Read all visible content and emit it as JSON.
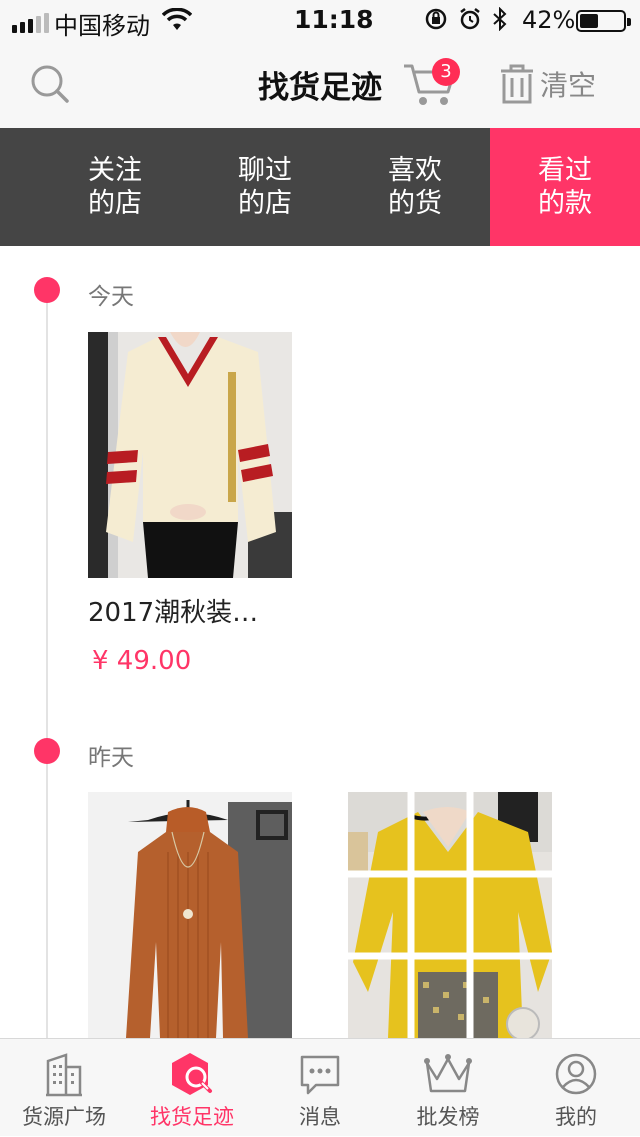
{
  "status_bar": {
    "carrier": "中国移动",
    "time": "11:18",
    "battery_percent": "42%",
    "battery_level": 0.42
  },
  "header": {
    "title": "找货足迹",
    "cart_count": "3",
    "clear_label": "清空",
    "icons": [
      "search-icon",
      "cart-icon",
      "trash-icon"
    ]
  },
  "tabs": [
    {
      "line1": "关注",
      "line2": "的店",
      "active": false
    },
    {
      "line1": "聊过",
      "line2": "的店",
      "active": false
    },
    {
      "line1": "喜欢",
      "line2": "的货",
      "active": false
    },
    {
      "line1": "看过",
      "line2": "的款",
      "active": true
    }
  ],
  "timeline": [
    {
      "date": "今天",
      "products": [
        {
          "name": "2017潮秋装…",
          "price": "¥ 49.00",
          "image": "cream-v-neck-sweater-with-red-stripes"
        }
      ]
    },
    {
      "date": "昨天",
      "products": [
        {
          "image": "rust-ribbed-turtleneck-sweater"
        },
        {
          "image": "yellow-v-neck-sweater-collage"
        }
      ]
    }
  ],
  "tabbar": [
    {
      "label": "货源广场",
      "icon": "building-icon",
      "active": false
    },
    {
      "label": "找货足迹",
      "icon": "footprint-search-icon",
      "active": true
    },
    {
      "label": "消息",
      "icon": "chat-bubble-icon",
      "active": false
    },
    {
      "label": "批发榜",
      "icon": "crown-icon",
      "active": false
    },
    {
      "label": "我的",
      "icon": "user-icon",
      "active": false
    }
  ],
  "colors": {
    "accent": "#ff3567",
    "tab_bar_bg": "#454545",
    "header_bg": "#f7f7f7"
  }
}
